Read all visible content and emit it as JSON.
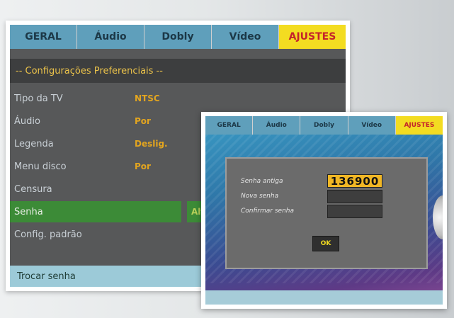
{
  "main_screen": {
    "tabs": [
      {
        "label": "GERAL"
      },
      {
        "label": "Áudio"
      },
      {
        "label": "Dobly"
      },
      {
        "label": "Vídeo"
      },
      {
        "label": "AJUSTES",
        "active": true
      }
    ],
    "section_header": "-- Configurações Preferenciais --",
    "menu": [
      {
        "label": "Tipo da TV",
        "value": "NTSC"
      },
      {
        "label": "Áudio",
        "value": "Por"
      },
      {
        "label": "Legenda",
        "value": "Deslig."
      },
      {
        "label": "Menu disco",
        "value": "Por"
      },
      {
        "label": "Censura",
        "value": ""
      },
      {
        "label": "Senha",
        "value": "Alt",
        "selected": true
      },
      {
        "label": "Config. padrão",
        "value": ""
      }
    ],
    "status_text": "Trocar senha"
  },
  "overlay_screen": {
    "tabs": [
      {
        "label": "GERAL"
      },
      {
        "label": "Áudio"
      },
      {
        "label": "Dobly"
      },
      {
        "label": "Vídeo"
      },
      {
        "label": "AJUSTES",
        "active": true
      }
    ],
    "dialog": {
      "old_password_label": "Senha antiga",
      "old_password_value": "136900",
      "new_password_label": "Nova senha",
      "new_password_value": "",
      "confirm_password_label": "Confirmar senha",
      "confirm_password_value": "",
      "ok_label": "OK"
    }
  },
  "colors": {
    "tab_bar": "#5f9fbb",
    "active_tab": "#f3dc21",
    "active_tab_text": "#c4232b",
    "menu_value": "#e3a51f",
    "selected_row": "#3c8b37",
    "password_highlight": "#f1b725"
  }
}
